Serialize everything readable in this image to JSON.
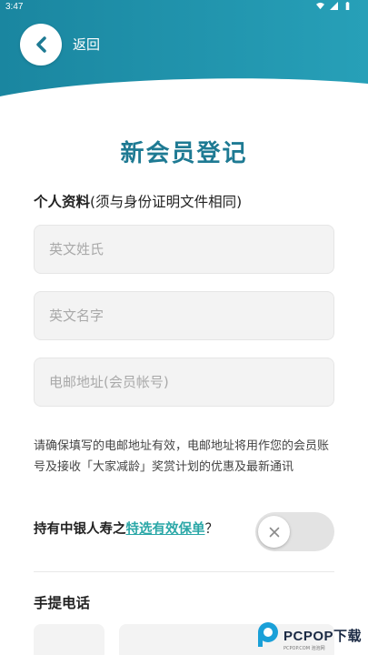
{
  "status_bar": {
    "time": "3:47",
    "icons": [
      "wifi-icon",
      "signal-icon",
      "battery-icon"
    ]
  },
  "header": {
    "back_label": "返回",
    "background_color": "#1e90a8"
  },
  "page_title": "新会员登记",
  "personal_section": {
    "label_bold": "个人资料",
    "label_note": "(须与身份证明文件相同)"
  },
  "fields": {
    "last_name": {
      "placeholder": "英文姓氏",
      "value": ""
    },
    "first_name": {
      "placeholder": "英文名字",
      "value": ""
    },
    "email": {
      "placeholder": "电邮地址(会员帐号)",
      "value": ""
    }
  },
  "notice": "请确保填写的电邮地址有效，电邮地址将用作您的会员账号及接收「大家减龄」奖赏计划的优惠及最新通讯",
  "insurer_question": {
    "prefix": "持有中银人寿之",
    "link": "特选有效保单",
    "suffix": "？",
    "toggle_on": false
  },
  "phone_section": {
    "label": "手提电话"
  },
  "watermark": {
    "brand": "PCPOP下载",
    "sub": "PCPOP.COM 泡泡网"
  },
  "colors": {
    "accent": "#1e7a93",
    "link": "#2aa7a7",
    "header": "#1e90a8"
  }
}
